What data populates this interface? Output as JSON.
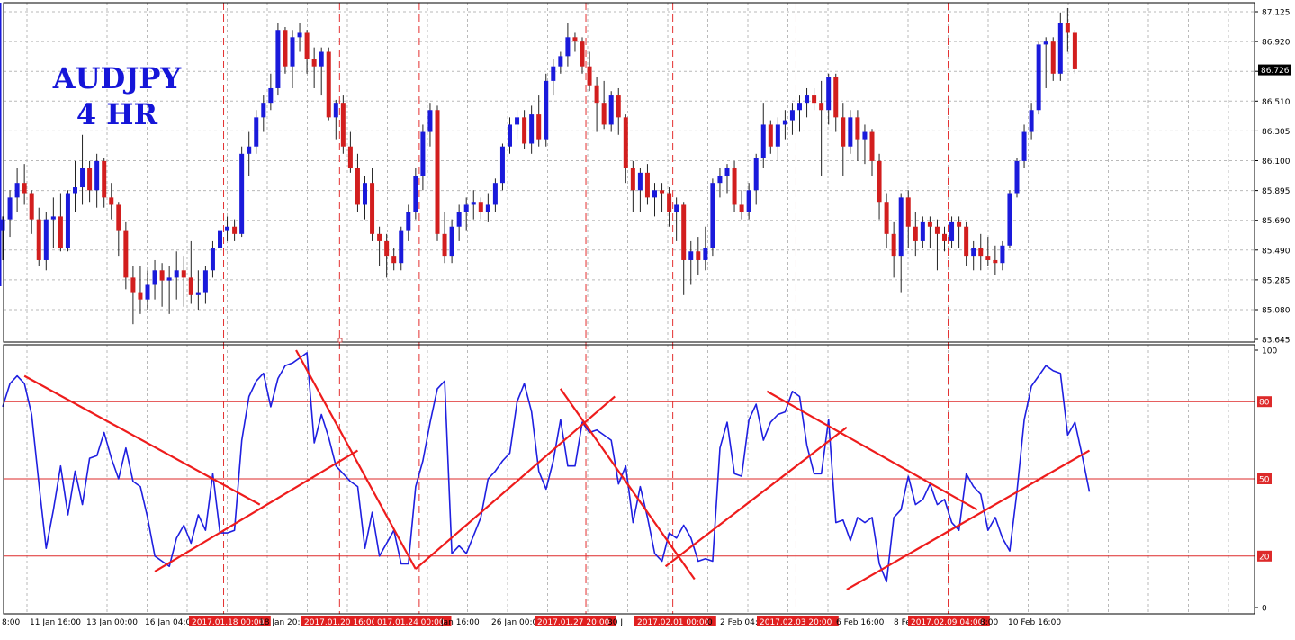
{
  "chart_data": {
    "type": "candlestick",
    "symbol_label": "AUDJPY",
    "timeframe_label": "4 HR",
    "colors": {
      "bull": "#1a1adb",
      "bear": "#d21e1e",
      "oscillator_line": "#1f1fe0",
      "trendline": "#ee1c1c",
      "level_line": "#dd2a2a",
      "marker_line": "#e43030",
      "grid": "#b9b9b9",
      "title": "#1515d8",
      "price_tag_bg": "#000000"
    },
    "price_axis": {
      "ylim": [
        84.9,
        87.2
      ],
      "ticks": [
        "87.125",
        "86.920",
        "86.715",
        "86.510",
        "86.305",
        "86.100",
        "85.895",
        "85.690",
        "85.490",
        "85.285",
        "85.080",
        "83.645"
      ],
      "current_price": "86.726"
    },
    "osc_axis": {
      "ylim": [
        0,
        100
      ],
      "ticks": [
        "100",
        "80",
        "50",
        "20",
        "0"
      ],
      "levels": [
        80,
        50,
        20
      ]
    },
    "candles": [
      [
        85.62,
        85.72,
        85.42,
        85.7
      ],
      [
        85.7,
        85.9,
        85.58,
        85.85
      ],
      [
        85.85,
        86.05,
        85.75,
        85.95
      ],
      [
        85.95,
        86.08,
        85.8,
        85.88
      ],
      [
        85.88,
        85.9,
        85.6,
        85.7
      ],
      [
        85.7,
        85.78,
        85.38,
        85.42
      ],
      [
        85.42,
        85.75,
        85.35,
        85.7
      ],
      [
        85.7,
        85.85,
        85.5,
        85.72
      ],
      [
        85.72,
        85.88,
        85.48,
        85.5
      ],
      [
        85.5,
        85.9,
        85.48,
        85.88
      ],
      [
        85.88,
        86.1,
        85.75,
        85.92
      ],
      [
        85.92,
        86.28,
        85.8,
        86.05
      ],
      [
        86.05,
        86.1,
        85.82,
        85.9
      ],
      [
        85.9,
        86.15,
        85.78,
        86.1
      ],
      [
        86.1,
        86.12,
        85.78,
        85.85
      ],
      [
        85.85,
        85.95,
        85.7,
        85.8
      ],
      [
        85.8,
        85.82,
        85.45,
        85.62
      ],
      [
        85.62,
        85.68,
        85.22,
        85.3
      ],
      [
        85.3,
        85.38,
        84.98,
        85.2
      ],
      [
        85.2,
        85.38,
        85.05,
        85.15
      ],
      [
        85.15,
        85.35,
        85.08,
        85.25
      ],
      [
        85.25,
        85.42,
        85.15,
        85.35
      ],
      [
        85.35,
        85.4,
        85.1,
        85.28
      ],
      [
        85.28,
        85.38,
        85.05,
        85.3
      ],
      [
        85.3,
        85.48,
        85.15,
        85.35
      ],
      [
        85.35,
        85.45,
        85.1,
        85.3
      ],
      [
        85.3,
        85.55,
        85.12,
        85.18
      ],
      [
        85.18,
        85.35,
        85.08,
        85.2
      ],
      [
        85.2,
        85.38,
        85.12,
        85.35
      ],
      [
        85.35,
        85.55,
        85.3,
        85.5
      ],
      [
        85.5,
        85.68,
        85.45,
        85.62
      ],
      [
        85.62,
        85.72,
        85.55,
        85.65
      ],
      [
        85.65,
        85.7,
        85.55,
        85.6
      ],
      [
        85.6,
        86.2,
        85.58,
        86.15
      ],
      [
        86.15,
        86.3,
        86.0,
        86.2
      ],
      [
        86.2,
        86.45,
        86.15,
        86.4
      ],
      [
        86.4,
        86.55,
        86.3,
        86.5
      ],
      [
        86.5,
        86.7,
        86.45,
        86.6
      ],
      [
        86.6,
        87.05,
        86.55,
        87.0
      ],
      [
        87.0,
        87.02,
        86.7,
        86.75
      ],
      [
        86.75,
        87.0,
        86.6,
        86.95
      ],
      [
        86.95,
        87.05,
        86.85,
        86.98
      ],
      [
        86.98,
        87.0,
        86.7,
        86.8
      ],
      [
        86.8,
        86.88,
        86.6,
        86.75
      ],
      [
        86.75,
        86.88,
        86.55,
        86.85
      ],
      [
        86.85,
        86.88,
        86.38,
        86.4
      ],
      [
        86.4,
        86.52,
        86.25,
        86.5
      ],
      [
        86.5,
        86.55,
        86.15,
        86.2
      ],
      [
        86.2,
        86.3,
        86.02,
        86.05
      ],
      [
        86.05,
        86.15,
        85.75,
        85.8
      ],
      [
        85.8,
        86.0,
        85.7,
        85.95
      ],
      [
        85.95,
        86.05,
        85.55,
        85.6
      ],
      [
        85.6,
        85.65,
        85.38,
        85.55
      ],
      [
        85.55,
        85.6,
        85.3,
        85.45
      ],
      [
        85.45,
        85.5,
        85.35,
        85.4
      ],
      [
        85.4,
        85.65,
        85.35,
        85.62
      ],
      [
        85.62,
        85.8,
        85.55,
        85.75
      ],
      [
        85.75,
        86.05,
        85.7,
        86.0
      ],
      [
        86.0,
        86.35,
        85.9,
        86.3
      ],
      [
        86.3,
        86.5,
        86.2,
        86.45
      ],
      [
        86.45,
        86.48,
        85.55,
        85.6
      ],
      [
        85.6,
        85.75,
        85.4,
        85.45
      ],
      [
        85.45,
        85.7,
        85.4,
        85.65
      ],
      [
        85.65,
        85.8,
        85.55,
        85.75
      ],
      [
        85.75,
        85.85,
        85.62,
        85.8
      ],
      [
        85.8,
        85.9,
        85.7,
        85.82
      ],
      [
        85.82,
        85.85,
        85.7,
        85.75
      ],
      [
        85.75,
        85.88,
        85.68,
        85.8
      ],
      [
        85.8,
        85.98,
        85.75,
        85.95
      ],
      [
        85.95,
        86.22,
        85.9,
        86.2
      ],
      [
        86.2,
        86.4,
        86.15,
        86.35
      ],
      [
        86.35,
        86.45,
        86.25,
        86.4
      ],
      [
        86.4,
        86.45,
        86.18,
        86.22
      ],
      [
        86.22,
        86.48,
        86.15,
        86.42
      ],
      [
        86.42,
        86.55,
        86.2,
        86.25
      ],
      [
        86.25,
        86.7,
        86.2,
        86.65
      ],
      [
        86.65,
        86.8,
        86.55,
        86.75
      ],
      [
        86.75,
        86.85,
        86.7,
        86.82
      ],
      [
        86.82,
        87.05,
        86.75,
        86.95
      ],
      [
        86.95,
        86.98,
        86.85,
        86.92
      ],
      [
        86.92,
        86.95,
        86.7,
        86.75
      ],
      [
        86.75,
        86.85,
        86.58,
        86.62
      ],
      [
        86.62,
        86.68,
        86.3,
        86.5
      ],
      [
        86.5,
        86.65,
        86.32,
        86.35
      ],
      [
        86.35,
        86.58,
        86.3,
        86.55
      ],
      [
        86.55,
        86.6,
        86.28,
        86.4
      ],
      [
        86.4,
        86.42,
        85.95,
        86.05
      ],
      [
        86.05,
        86.1,
        85.75,
        85.9
      ],
      [
        85.9,
        86.05,
        85.75,
        86.02
      ],
      [
        86.02,
        86.08,
        85.8,
        85.85
      ],
      [
        85.85,
        85.95,
        85.72,
        85.9
      ],
      [
        85.9,
        85.95,
        85.75,
        85.88
      ],
      [
        85.88,
        85.92,
        85.65,
        85.75
      ],
      [
        85.75,
        85.85,
        85.55,
        85.8
      ],
      [
        85.8,
        85.82,
        85.18,
        85.42
      ],
      [
        85.42,
        85.55,
        85.25,
        85.48
      ],
      [
        85.48,
        85.58,
        85.32,
        85.42
      ],
      [
        85.42,
        85.65,
        85.35,
        85.5
      ],
      [
        85.5,
        85.98,
        85.45,
        85.95
      ],
      [
        85.95,
        86.05,
        85.85,
        86.0
      ],
      [
        86.0,
        86.08,
        85.88,
        86.05
      ],
      [
        86.05,
        86.1,
        85.75,
        85.8
      ],
      [
        85.8,
        85.9,
        85.7,
        85.75
      ],
      [
        85.75,
        85.95,
        85.7,
        85.9
      ],
      [
        85.9,
        86.15,
        85.8,
        86.12
      ],
      [
        86.12,
        86.5,
        86.05,
        86.35
      ],
      [
        86.35,
        86.38,
        86.15,
        86.2
      ],
      [
        86.2,
        86.4,
        86.1,
        86.35
      ],
      [
        86.35,
        86.45,
        86.25,
        86.38
      ],
      [
        86.38,
        86.5,
        86.28,
        86.45
      ],
      [
        86.45,
        86.55,
        86.3,
        86.5
      ],
      [
        86.5,
        86.6,
        86.4,
        86.55
      ],
      [
        86.55,
        86.6,
        86.45,
        86.5
      ],
      [
        86.5,
        86.65,
        86.0,
        86.45
      ],
      [
        86.45,
        86.7,
        86.35,
        86.68
      ],
      [
        86.68,
        86.7,
        86.3,
        86.4
      ],
      [
        86.4,
        86.5,
        86.0,
        86.2
      ],
      [
        86.2,
        86.45,
        86.15,
        86.4
      ],
      [
        86.4,
        86.45,
        86.1,
        86.25
      ],
      [
        86.25,
        86.35,
        86.08,
        86.3
      ],
      [
        86.3,
        86.32,
        86.0,
        86.1
      ],
      [
        86.1,
        86.15,
        85.7,
        85.82
      ],
      [
        85.82,
        85.88,
        85.5,
        85.6
      ],
      [
        85.6,
        85.68,
        85.3,
        85.45
      ],
      [
        85.45,
        85.88,
        85.2,
        85.85
      ],
      [
        85.85,
        85.9,
        85.5,
        85.65
      ],
      [
        85.65,
        85.75,
        85.45,
        85.55
      ],
      [
        85.55,
        85.72,
        85.5,
        85.68
      ],
      [
        85.68,
        85.72,
        85.5,
        85.65
      ],
      [
        85.65,
        85.7,
        85.35,
        85.6
      ],
      [
        85.6,
        85.65,
        85.48,
        85.55
      ],
      [
        85.55,
        85.72,
        85.5,
        85.68
      ],
      [
        85.68,
        85.72,
        85.5,
        85.65
      ],
      [
        85.65,
        85.68,
        85.38,
        85.45
      ],
      [
        85.45,
        85.55,
        85.35,
        85.5
      ],
      [
        85.5,
        85.6,
        85.35,
        85.45
      ],
      [
        85.45,
        85.58,
        85.38,
        85.42
      ],
      [
        85.42,
        85.52,
        85.32,
        85.4
      ],
      [
        85.4,
        85.55,
        85.35,
        85.52
      ],
      [
        85.52,
        85.9,
        85.5,
        85.88
      ],
      [
        85.88,
        86.12,
        85.85,
        86.1
      ],
      [
        86.1,
        86.35,
        86.05,
        86.3
      ],
      [
        86.3,
        86.5,
        86.25,
        86.45
      ],
      [
        86.45,
        86.92,
        86.42,
        86.9
      ],
      [
        86.9,
        86.95,
        86.6,
        86.92
      ],
      [
        86.92,
        86.95,
        86.65,
        86.7
      ],
      [
        86.7,
        87.12,
        86.65,
        87.05
      ],
      [
        87.05,
        87.15,
        86.85,
        86.98
      ],
      [
        86.98,
        87.0,
        86.7,
        86.73
      ]
    ],
    "oscillator_values": [
      78,
      87,
      90,
      87,
      75,
      48,
      23,
      38,
      55,
      36,
      53,
      40,
      58,
      59,
      68,
      58,
      50,
      62,
      49,
      47,
      35,
      20,
      18,
      16,
      27,
      32,
      25,
      36,
      30,
      52,
      29,
      29,
      30,
      65,
      82,
      88,
      91,
      78,
      89,
      94,
      95,
      97,
      99,
      64,
      75,
      66,
      55,
      52,
      49,
      47,
      23,
      37,
      20,
      25,
      30,
      17,
      17,
      47,
      57,
      72,
      85,
      88,
      21,
      24,
      21,
      28,
      35,
      50,
      53,
      57,
      60,
      80,
      87,
      76,
      53,
      46,
      57,
      73,
      55,
      55,
      72,
      68,
      69,
      67,
      65,
      48,
      55,
      33,
      47,
      35,
      21,
      18,
      29,
      27,
      32,
      27,
      18,
      19,
      18,
      62,
      72,
      52,
      51,
      73,
      79,
      65,
      72,
      75,
      76,
      84,
      82,
      63,
      52,
      52,
      73,
      33,
      34,
      26,
      35,
      33,
      35,
      17,
      10,
      35,
      38,
      51,
      40,
      42,
      48,
      40,
      42,
      33,
      30,
      52,
      47,
      44,
      30,
      35,
      27,
      22,
      45,
      73,
      86,
      90,
      94,
      92,
      91,
      67,
      72,
      59,
      45
    ],
    "time_labels": [
      "8:00",
      "11 Jan 16:00",
      "13 Jan 00:00",
      "16 Jan 04:00",
      "2017.01.18 00:00",
      "18 Jan 20:00",
      "2017.01.20 16:00",
      "017.01.24 00:00",
      "Jan 16:00",
      "26 Jan 00:00",
      "2017.01.27 20:00",
      "30 J",
      "2017.02.01 00:00",
      "0",
      "2 Feb 04:",
      "2017.02.03 20:00",
      "6 Feb 16:00",
      "8 Fe",
      "2017.02.09 04:00",
      "8:00",
      "10 Feb 16:00"
    ],
    "highlighted_time_labels": [
      "2017.01.18 00:00",
      "2017.01.20 16:00",
      "017.01.24 00:00",
      "2017.01.27 20:00",
      "2017.02.01 00:00",
      "2017.02.03 20:00",
      "2017.02.09 04:00"
    ],
    "vertical_markers_candle_index": [
      30.5,
      46.5,
      57.5,
      80.5,
      92.5,
      109.5,
      130.5
    ],
    "trendlines": [
      {
        "from": [
          3,
          90
        ],
        "to": [
          35.5,
          40
        ]
      },
      {
        "from": [
          21,
          14
        ],
        "to": [
          49,
          61
        ]
      },
      {
        "from": [
          40.5,
          100
        ],
        "to": [
          57,
          15
        ]
      },
      {
        "from": [
          57,
          15
        ],
        "to": [
          84.5,
          82
        ]
      },
      {
        "from": [
          77,
          85
        ],
        "to": [
          95.5,
          11
        ]
      },
      {
        "from": [
          91.5,
          16
        ],
        "to": [
          116.5,
          70
        ]
      },
      {
        "from": [
          105.5,
          84
        ],
        "to": [
          134.5,
          38
        ]
      },
      {
        "from": [
          116.5,
          7
        ],
        "to": [
          150,
          61
        ]
      }
    ]
  }
}
